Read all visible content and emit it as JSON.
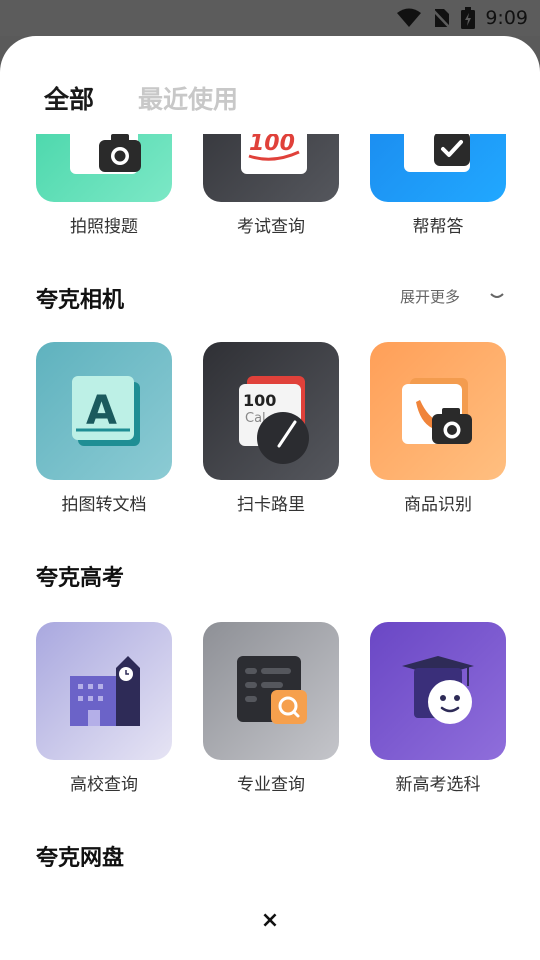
{
  "status_bar": {
    "time": "9:09"
  },
  "tabs": [
    {
      "label": "全部"
    },
    {
      "label": "最近使用"
    }
  ],
  "top_row": [
    {
      "label": "拍照搜题",
      "icon": "camera-icon"
    },
    {
      "label": "考试查询",
      "icon": "exam-score-icon"
    },
    {
      "label": "帮帮答",
      "icon": "check-icon"
    }
  ],
  "sections": [
    {
      "title": "夸克相机",
      "more_label": "展开更多",
      "items": [
        {
          "label": "拍图转文档",
          "icon": "document-a-icon"
        },
        {
          "label": "扫卡路里",
          "icon": "calorie-scale-icon"
        },
        {
          "label": "商品识别",
          "icon": "product-camera-icon"
        }
      ]
    },
    {
      "title": "夸克高考",
      "items": [
        {
          "label": "高校查询",
          "icon": "school-building-icon"
        },
        {
          "label": "专业查询",
          "icon": "major-search-icon"
        },
        {
          "label": "新高考选科",
          "icon": "graduate-cap-icon"
        }
      ]
    },
    {
      "title": "夸克网盘"
    }
  ],
  "close_symbol": "×",
  "score_text": "100",
  "calorie_text": "100",
  "calorie_unit": "Cal",
  "doc_letter": "A"
}
